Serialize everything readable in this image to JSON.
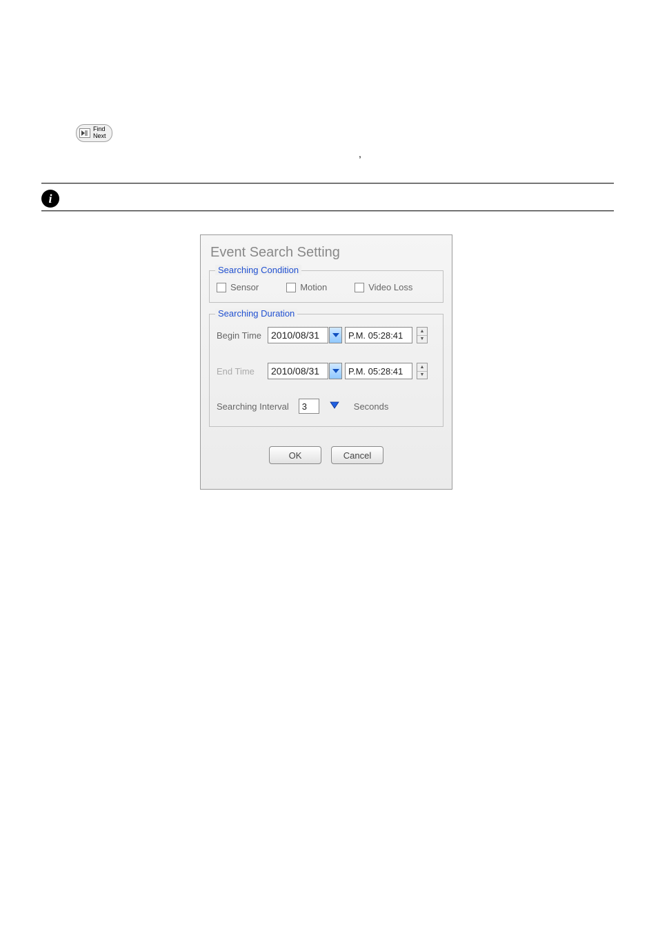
{
  "findNext": {
    "line1": "Find",
    "line2": "Next"
  },
  "commaText": ",",
  "dialog": {
    "title": "Event Search Setting",
    "conditionLegend": "Searching Condition",
    "conditions": {
      "sensor": "Sensor",
      "motion": "Motion",
      "videoLoss": "Video Loss"
    },
    "durationLegend": "Searching Duration",
    "beginLabel": "Begin Time",
    "beginDate": "2010/08/31",
    "beginTime": "P.M. 05:28:41",
    "endLabel": "End Time",
    "endDate": "2010/08/31",
    "endTime": "P.M. 05:28:41",
    "intervalLabel": "Searching Interval",
    "intervalValue": "3",
    "intervalUnit": "Seconds",
    "okLabel": "OK",
    "cancelLabel": "Cancel"
  }
}
